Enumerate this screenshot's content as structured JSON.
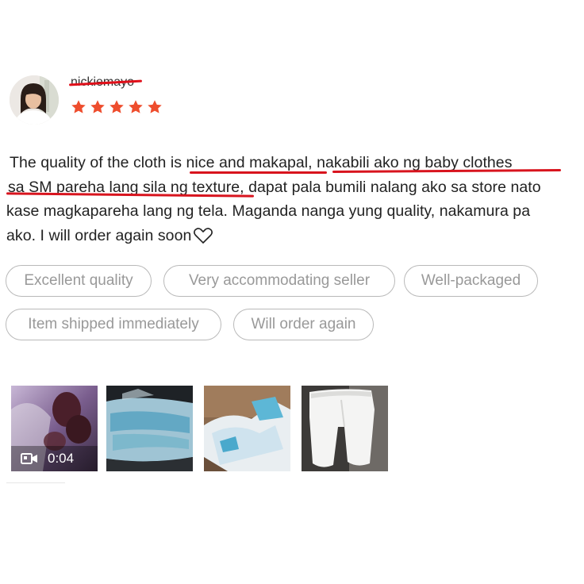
{
  "review": {
    "username": "nickiemayo",
    "rating": 5,
    "rating_stars": [
      "★",
      "★",
      "★",
      "★",
      "★"
    ],
    "star_color": "#ee4d2d",
    "comment_lines": [
      "The quality of the cloth is nice and makapal, nakabili ako ng baby clothes",
      "sa SM pareha lang sila ng texture, dapat pala bumili nalang ako sa store nato",
      "kase magkapareha lang ng tela. Maganda nanga yung quality, nakamura pa",
      "ako. I will order again soon"
    ],
    "comment_end_icon": "heart-outline-icon",
    "tags": [
      "Excellent quality",
      "Very accommodating seller",
      "Well-packaged",
      "Item shipped immediately",
      "Will order again"
    ],
    "media": {
      "video_duration": "0:04",
      "video_icon": "video-camera-icon",
      "photo_count": 4
    },
    "annotation_color": "#d8141e"
  }
}
